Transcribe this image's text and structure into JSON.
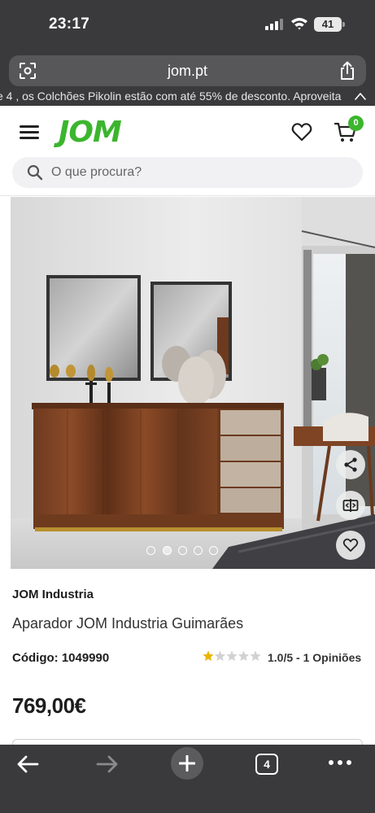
{
  "status_bar": {
    "time": "23:17",
    "battery": "41"
  },
  "browser": {
    "url": "jom.pt",
    "tab_count": "4"
  },
  "promo": {
    "text": "e 4 , os Colchões Pikolin estão com até 55% de desconto. Aproveita"
  },
  "header": {
    "logo": "JOM",
    "cart_count": "0"
  },
  "search": {
    "placeholder": "O que procura?"
  },
  "gallery": {
    "image_count": 5,
    "active_index": 1
  },
  "product": {
    "brand": "JOM Industria",
    "title": "Aparador JOM Industria Guimarães",
    "code": "Código: 1049990",
    "rating": 1.0,
    "rating_text": "1.0/5 - 1 Opiniões",
    "price": "769,00€"
  },
  "colors": {
    "brand_green": "#3cb52e",
    "ios_chrome": "#3a3a3c",
    "star_gold": "#e8b400"
  }
}
